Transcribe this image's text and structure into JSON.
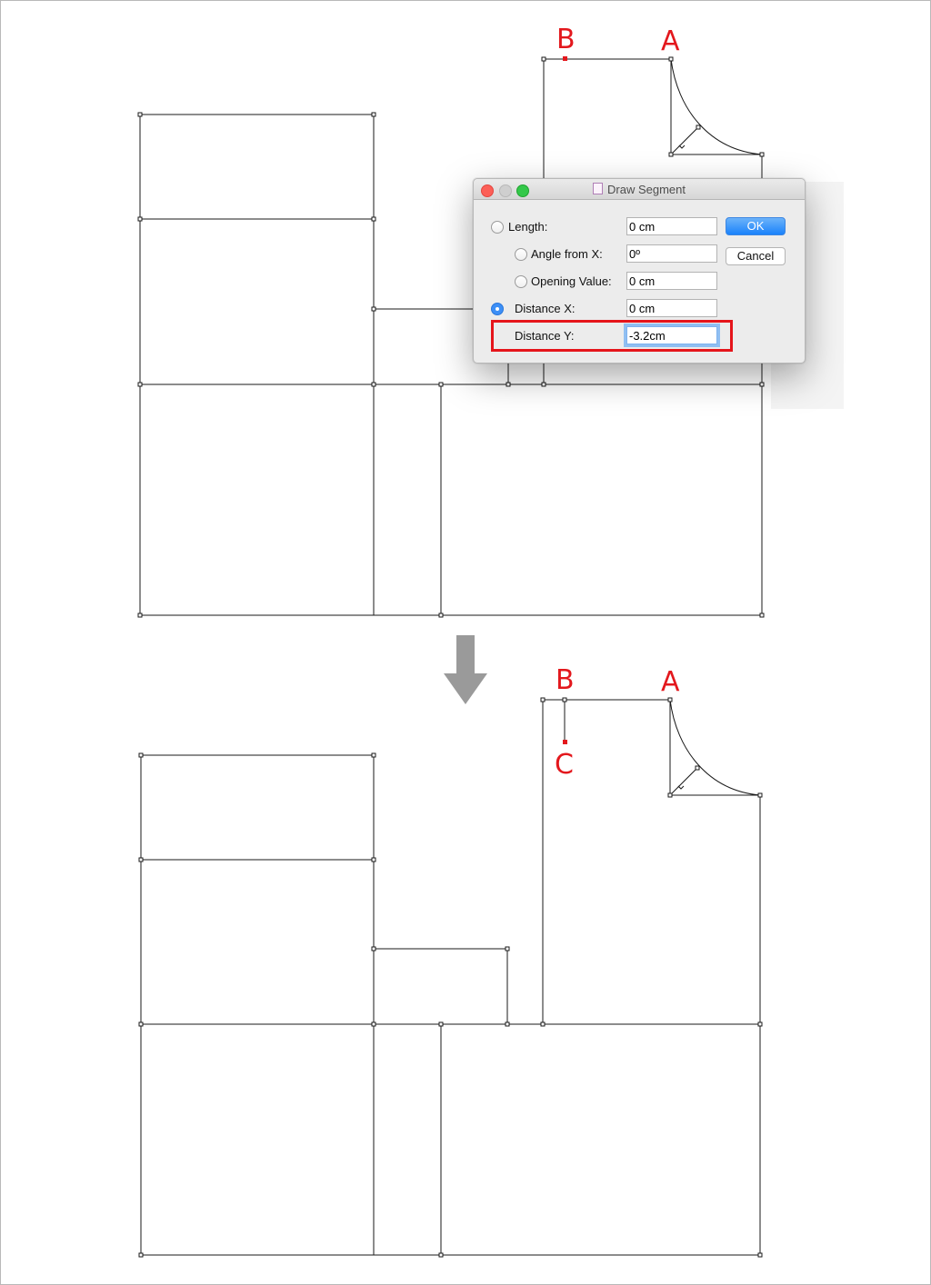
{
  "points": {
    "a": "A",
    "b": "B",
    "c": "C"
  },
  "dialog": {
    "title": "Draw Segment",
    "length_label": "Length:",
    "length_value": "0 cm",
    "angle_label": "Angle from X:",
    "angle_value": "0º",
    "opening_label": "Opening Value:",
    "opening_value": "0 cm",
    "distance_x_label": "Distance X:",
    "distance_x_value": "0 cm",
    "distance_y_label": "Distance Y:",
    "distance_y_value": "-3.2cm",
    "ok_label": "OK",
    "cancel_label": "Cancel",
    "selected_option": "distance_x"
  },
  "colors": {
    "accent": "#e3181d",
    "selection": "#3d8ff6",
    "arrow": "#9a9a9a"
  },
  "icons": {
    "arrow": "arrow-down-icon",
    "doc": "document-icon"
  }
}
